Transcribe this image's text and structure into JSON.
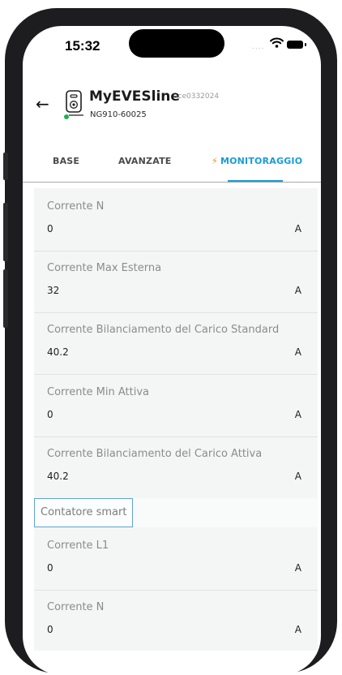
{
  "status_bar": {
    "time": "15:32",
    "signal": "....",
    "icons": [
      "wifi-icon",
      "battery-icon"
    ]
  },
  "header": {
    "back_icon": "arrow-left-icon",
    "device_icon": "charger-icon",
    "device_name": "MyEVESline",
    "device_code": "ace0332024",
    "device_serial": "NG910-60025",
    "online_color": "#1faf54"
  },
  "tabs": [
    {
      "label": "BASE",
      "active": false
    },
    {
      "label": "AVANZATE",
      "active": false
    },
    {
      "label": "MONITORAGGIO",
      "active": true,
      "icon": "lightning-bolt-icon"
    }
  ],
  "colors": {
    "accent": "#1b9bd8",
    "bolt": "#f28a22"
  },
  "rows": [
    {
      "label": "Corrente N",
      "value": "0",
      "unit": "A"
    },
    {
      "label": "Corrente Max Esterna",
      "value": "32",
      "unit": "A"
    },
    {
      "label": "Corrente Bilanciamento del Carico Standard",
      "value": "40.2",
      "unit": "A"
    },
    {
      "label": "Corrente Min Attiva",
      "value": "0",
      "unit": "A"
    },
    {
      "label": "Corrente Bilanciamento del Carico Attiva",
      "value": "40.2",
      "unit": "A"
    }
  ],
  "section": {
    "label": "Contatore smart"
  },
  "smart_rows": [
    {
      "label": "Corrente L1",
      "value": "0",
      "unit": "A"
    },
    {
      "label": "Corrente N",
      "value": "0",
      "unit": "A"
    }
  ]
}
